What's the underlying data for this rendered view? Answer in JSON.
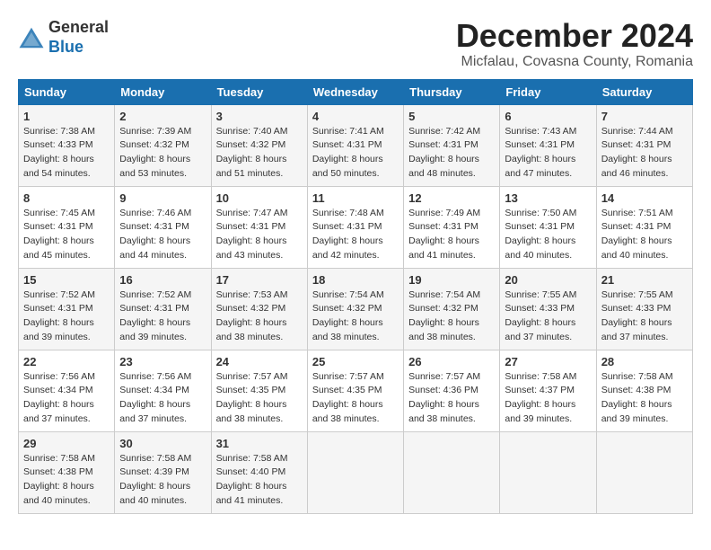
{
  "logo": {
    "general": "General",
    "blue": "Blue"
  },
  "title": "December 2024",
  "subtitle": "Micfalau, Covasna County, Romania",
  "days_of_week": [
    "Sunday",
    "Monday",
    "Tuesday",
    "Wednesday",
    "Thursday",
    "Friday",
    "Saturday"
  ],
  "weeks": [
    [
      {
        "day": "1",
        "sunrise": "7:38 AM",
        "sunset": "4:33 PM",
        "daylight": "8 hours and 54 minutes."
      },
      {
        "day": "2",
        "sunrise": "7:39 AM",
        "sunset": "4:32 PM",
        "daylight": "8 hours and 53 minutes."
      },
      {
        "day": "3",
        "sunrise": "7:40 AM",
        "sunset": "4:32 PM",
        "daylight": "8 hours and 51 minutes."
      },
      {
        "day": "4",
        "sunrise": "7:41 AM",
        "sunset": "4:31 PM",
        "daylight": "8 hours and 50 minutes."
      },
      {
        "day": "5",
        "sunrise": "7:42 AM",
        "sunset": "4:31 PM",
        "daylight": "8 hours and 48 minutes."
      },
      {
        "day": "6",
        "sunrise": "7:43 AM",
        "sunset": "4:31 PM",
        "daylight": "8 hours and 47 minutes."
      },
      {
        "day": "7",
        "sunrise": "7:44 AM",
        "sunset": "4:31 PM",
        "daylight": "8 hours and 46 minutes."
      }
    ],
    [
      {
        "day": "8",
        "sunrise": "7:45 AM",
        "sunset": "4:31 PM",
        "daylight": "8 hours and 45 minutes."
      },
      {
        "day": "9",
        "sunrise": "7:46 AM",
        "sunset": "4:31 PM",
        "daylight": "8 hours and 44 minutes."
      },
      {
        "day": "10",
        "sunrise": "7:47 AM",
        "sunset": "4:31 PM",
        "daylight": "8 hours and 43 minutes."
      },
      {
        "day": "11",
        "sunrise": "7:48 AM",
        "sunset": "4:31 PM",
        "daylight": "8 hours and 42 minutes."
      },
      {
        "day": "12",
        "sunrise": "7:49 AM",
        "sunset": "4:31 PM",
        "daylight": "8 hours and 41 minutes."
      },
      {
        "day": "13",
        "sunrise": "7:50 AM",
        "sunset": "4:31 PM",
        "daylight": "8 hours and 40 minutes."
      },
      {
        "day": "14",
        "sunrise": "7:51 AM",
        "sunset": "4:31 PM",
        "daylight": "8 hours and 40 minutes."
      }
    ],
    [
      {
        "day": "15",
        "sunrise": "7:52 AM",
        "sunset": "4:31 PM",
        "daylight": "8 hours and 39 minutes."
      },
      {
        "day": "16",
        "sunrise": "7:52 AM",
        "sunset": "4:31 PM",
        "daylight": "8 hours and 39 minutes."
      },
      {
        "day": "17",
        "sunrise": "7:53 AM",
        "sunset": "4:32 PM",
        "daylight": "8 hours and 38 minutes."
      },
      {
        "day": "18",
        "sunrise": "7:54 AM",
        "sunset": "4:32 PM",
        "daylight": "8 hours and 38 minutes."
      },
      {
        "day": "19",
        "sunrise": "7:54 AM",
        "sunset": "4:32 PM",
        "daylight": "8 hours and 38 minutes."
      },
      {
        "day": "20",
        "sunrise": "7:55 AM",
        "sunset": "4:33 PM",
        "daylight": "8 hours and 37 minutes."
      },
      {
        "day": "21",
        "sunrise": "7:55 AM",
        "sunset": "4:33 PM",
        "daylight": "8 hours and 37 minutes."
      }
    ],
    [
      {
        "day": "22",
        "sunrise": "7:56 AM",
        "sunset": "4:34 PM",
        "daylight": "8 hours and 37 minutes."
      },
      {
        "day": "23",
        "sunrise": "7:56 AM",
        "sunset": "4:34 PM",
        "daylight": "8 hours and 37 minutes."
      },
      {
        "day": "24",
        "sunrise": "7:57 AM",
        "sunset": "4:35 PM",
        "daylight": "8 hours and 38 minutes."
      },
      {
        "day": "25",
        "sunrise": "7:57 AM",
        "sunset": "4:35 PM",
        "daylight": "8 hours and 38 minutes."
      },
      {
        "day": "26",
        "sunrise": "7:57 AM",
        "sunset": "4:36 PM",
        "daylight": "8 hours and 38 minutes."
      },
      {
        "day": "27",
        "sunrise": "7:58 AM",
        "sunset": "4:37 PM",
        "daylight": "8 hours and 39 minutes."
      },
      {
        "day": "28",
        "sunrise": "7:58 AM",
        "sunset": "4:38 PM",
        "daylight": "8 hours and 39 minutes."
      }
    ],
    [
      {
        "day": "29",
        "sunrise": "7:58 AM",
        "sunset": "4:38 PM",
        "daylight": "8 hours and 40 minutes."
      },
      {
        "day": "30",
        "sunrise": "7:58 AM",
        "sunset": "4:39 PM",
        "daylight": "8 hours and 40 minutes."
      },
      {
        "day": "31",
        "sunrise": "7:58 AM",
        "sunset": "4:40 PM",
        "daylight": "8 hours and 41 minutes."
      },
      null,
      null,
      null,
      null
    ]
  ]
}
